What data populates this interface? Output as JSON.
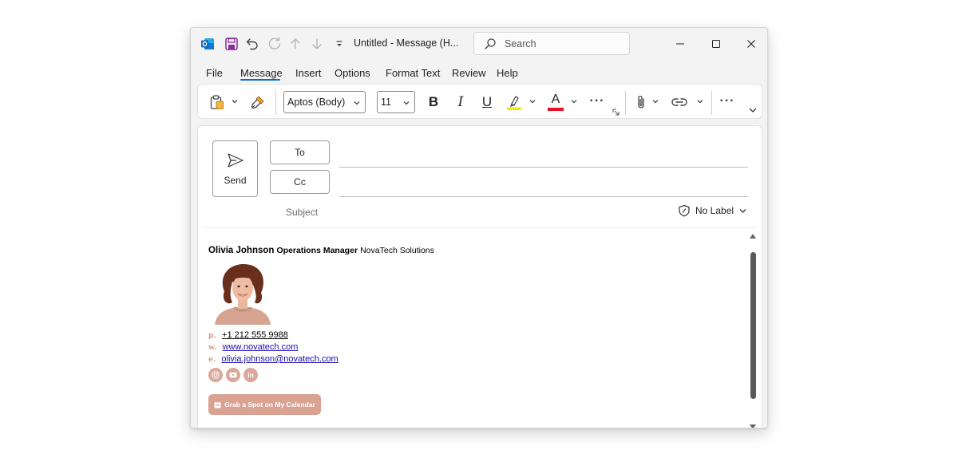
{
  "window": {
    "title": "Untitled  -  Message (H...",
    "search_placeholder": "Search"
  },
  "menu": {
    "tabs": [
      {
        "label": "File"
      },
      {
        "label": "Message",
        "active": true
      },
      {
        "label": "Insert"
      },
      {
        "label": "Options"
      },
      {
        "label": "Format Text"
      },
      {
        "label": "Review"
      },
      {
        "label": "Help"
      }
    ]
  },
  "ribbon": {
    "font_name": "Aptos (Body)",
    "font_size": "11",
    "bold": "B",
    "italic": "I",
    "underline": "U",
    "font_color_letter": "A",
    "more": "···",
    "highlight_color": "#f6e600",
    "font_color": "#e81123"
  },
  "compose": {
    "send_label": "Send",
    "to_label": "To",
    "cc_label": "Cc",
    "subject_label": "Subject",
    "sensitivity_label": "No Label"
  },
  "signature": {
    "name": "Olivia Johnson",
    "role": "Operations Manager",
    "company": "NovaTech Solutions",
    "phone_prefix": "p.",
    "phone": "+1 212 555 9988",
    "web_prefix": "w.",
    "website": "www.novatech.com",
    "email_prefix": "e.",
    "email": "olivia.johnson@novatech.com",
    "social_icons": [
      "instagram-icon",
      "youtube-icon",
      "linkedin-icon"
    ],
    "cta_label": "Grab a Spot on My Calendar",
    "accent_color": "#d9a293"
  }
}
